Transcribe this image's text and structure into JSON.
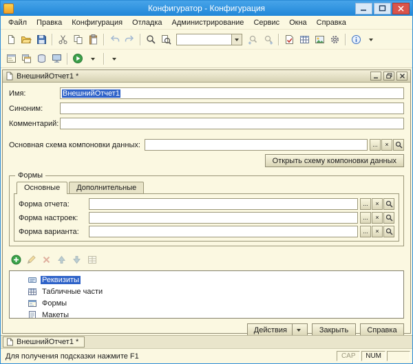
{
  "window": {
    "title": "Конфигуратор - Конфигурация"
  },
  "menubar": {
    "items": [
      "Файл",
      "Правка",
      "Конфигурация",
      "Отладка",
      "Администрирование",
      "Сервис",
      "Окна",
      "Справка"
    ]
  },
  "doc": {
    "title": "ВнешнийОтчет1 *",
    "name_label": "Имя:",
    "name_value": "ВнешнийОтчет1",
    "synonym_label": "Синоним:",
    "synonym_value": "",
    "comment_label": "Комментарий:",
    "comment_value": "",
    "schema_label": "Основная схема компоновки данных:",
    "schema_value": "",
    "open_schema_button": "Открыть схему компоновки данных",
    "forms": {
      "legend": "Формы",
      "tabs": [
        {
          "label": "Основные",
          "active": true
        },
        {
          "label": "Дополнительные",
          "active": false
        }
      ],
      "rows": [
        {
          "label": "Форма отчета:",
          "value": ""
        },
        {
          "label": "Форма настроек:",
          "value": ""
        },
        {
          "label": "Форма варианта:",
          "value": ""
        }
      ]
    },
    "tree": {
      "items": [
        {
          "label": "Реквизиты",
          "selected": true,
          "icon": "attributes"
        },
        {
          "label": "Табличные части",
          "selected": false,
          "icon": "tabular-sections"
        },
        {
          "label": "Формы",
          "selected": false,
          "icon": "forms"
        },
        {
          "label": "Макеты",
          "selected": false,
          "icon": "templates"
        }
      ]
    },
    "buttons": {
      "actions": "Действия",
      "close": "Закрыть",
      "help": "Справка"
    }
  },
  "field_buttons": {
    "choose": "...",
    "clear": "×"
  },
  "taskbar": {
    "active_tab": "ВнешнийОтчет1 *"
  },
  "statusbar": {
    "hint": "Для получения подсказки нажмите F1",
    "cap": "CAP",
    "num": "NUM"
  },
  "colors": {
    "selection": "#2e62c8",
    "titlebar_blue": "#2a8fe0",
    "background_cream": "#fbf8e1",
    "close_red": "#d9544a"
  },
  "icons": {
    "toolbar_main": [
      "new-document",
      "open",
      "save",
      "cut",
      "copy",
      "paste",
      "undo",
      "redo",
      "find",
      "find-in-files",
      "search-combo",
      "find-previous",
      "find-next",
      "syntax-check",
      "table",
      "picture",
      "settings",
      "info",
      "toolbar-overflow"
    ],
    "toolbar_config": [
      "configuration-window",
      "configuration-objects",
      "database-structure",
      "monitor",
      "database",
      "start-debugging",
      "debug-menu",
      "toolbar-overflow"
    ],
    "edit_toolbar": [
      "add",
      "edit",
      "delete",
      "move-up",
      "move-down",
      "sort"
    ],
    "tree_icons": [
      "attributes",
      "tabular-sections",
      "forms",
      "templates"
    ]
  }
}
